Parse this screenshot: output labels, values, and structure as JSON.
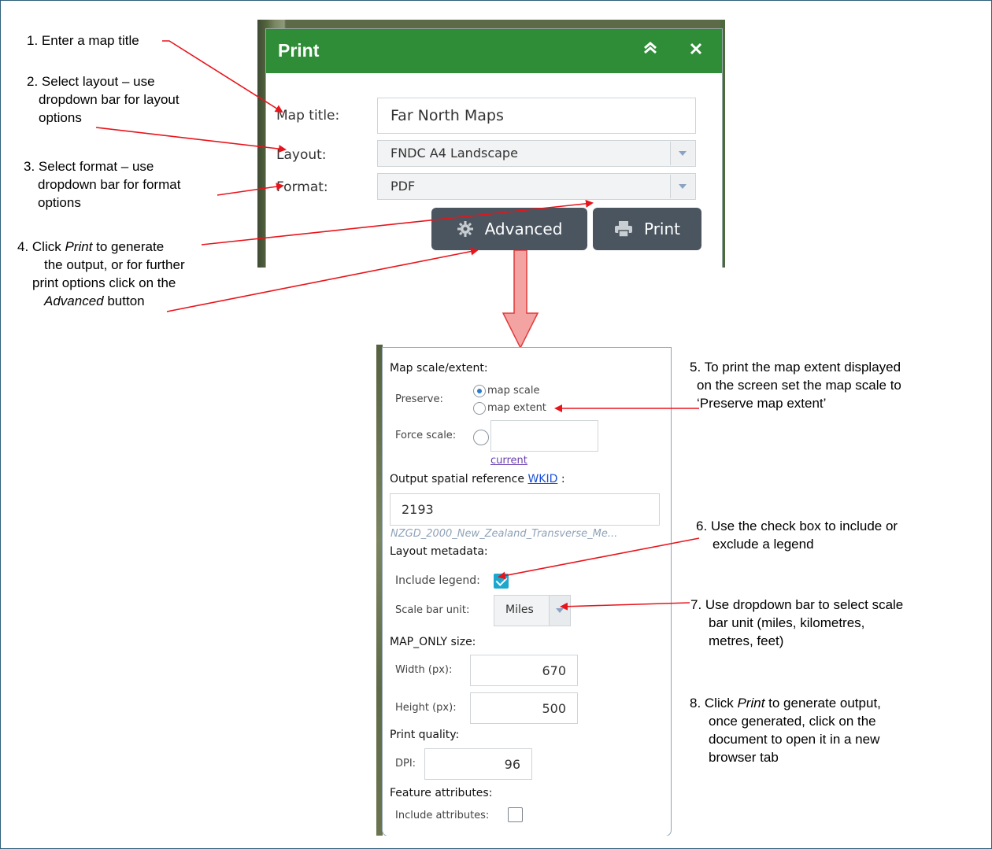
{
  "notes": {
    "n1": "1. Enter a map title",
    "n2_l1": "2. Select layout – use",
    "n2_l2": "dropdown bar for layout",
    "n2_l3": "options",
    "n3_l1": "3. Select format – use",
    "n3_l2": "dropdown bar for format",
    "n3_l3": "options",
    "n4_l1_a": "4. Click ",
    "n4_l1_em": "Print",
    "n4_l1_b": " to generate",
    "n4_l2": "the output, or for further",
    "n4_l3": "print options click on the",
    "n4_l4_em": "Advanced",
    "n4_l4_b": " button",
    "n5_l1": "5. To print the map extent displayed",
    "n5_l2": "on the screen set the map scale to",
    "n5_l3": "‘Preserve map extent’",
    "n6_l1": "6. Use the check box to include or",
    "n6_l2": "exclude a legend",
    "n7_l1": "7. Use dropdown bar to select scale",
    "n7_l2": "bar unit (miles, kilometres,",
    "n7_l3": "metres, feet)",
    "n8_l1_a": "8. Click ",
    "n8_l1_em": "Print",
    "n8_l1_b": " to generate output,",
    "n8_l2": "once generated, click on the",
    "n8_l3": "document to open it in a new",
    "n8_l4": "browser tab"
  },
  "print_panel": {
    "title": "Print",
    "collapse_icon": "double-chevron-up-icon",
    "close_icon": "close-icon",
    "map_title_label": "Map title:",
    "map_title_value": "Far North Maps",
    "layout_label": "Layout:",
    "layout_value": "FNDC A4 Landscape",
    "format_label": "Format:",
    "format_value": "PDF",
    "advanced_label": "Advanced",
    "print_label": "Print",
    "header_color": "#2f8c37"
  },
  "advanced_panel": {
    "map_scale_heading": "Map scale/extent:",
    "preserve_label": "Preserve:",
    "option_map_scale": "map scale",
    "option_map_extent": "map extent",
    "force_scale_label": "Force scale:",
    "current_link": "current",
    "spatial_ref_label": "Output spatial reference",
    "wkid_link": "WKID",
    "spatial_ref_colon": " :",
    "wkid_value": "2193",
    "wkid_description": "NZGD_2000_New_Zealand_Transverse_Me...",
    "layout_metadata_heading": "Layout metadata:",
    "include_legend_label": "Include legend:",
    "include_legend_checked": true,
    "scale_bar_unit_label": "Scale bar unit:",
    "scale_bar_unit_value": "Miles",
    "map_only_heading": "MAP_ONLY size:",
    "width_label": "Width (px):",
    "width_value": "670",
    "height_label": "Height (px):",
    "height_value": "500",
    "print_quality_heading": "Print quality:",
    "dpi_label": "DPI:",
    "dpi_value": "96",
    "feature_attributes_heading": "Feature attributes:",
    "include_attributes_label": "Include attributes:",
    "include_attributes_checked": false,
    "checkbox_color": "#1ea7cd"
  },
  "colors": {
    "annotation_arrow": "#e8141b",
    "big_arrow_fill": "#f4a3a3",
    "big_arrow_stroke": "#e03a3a",
    "button_dark": "#4a5560"
  }
}
